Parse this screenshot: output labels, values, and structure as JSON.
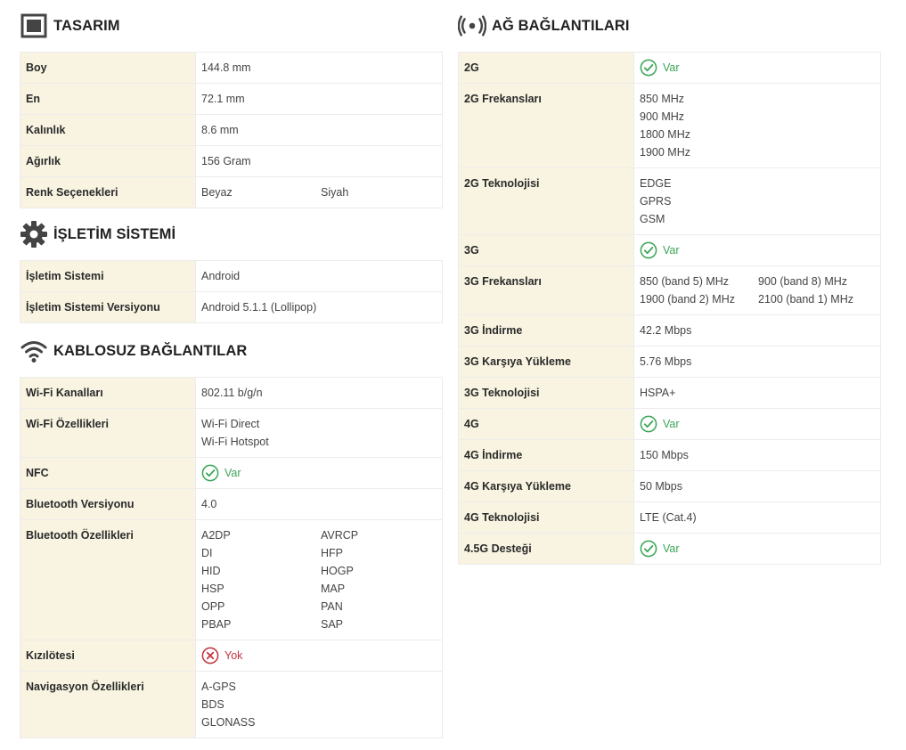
{
  "colors": {
    "key_bg": "#f8f4e1",
    "border": "#ececec",
    "yes": "#3aa556",
    "no": "#c2323d"
  },
  "left": {
    "design": {
      "title": "TASARIM",
      "icon": "frame-icon",
      "rows": [
        {
          "k": "Boy",
          "v": [
            "144.8 mm"
          ]
        },
        {
          "k": "En",
          "v": [
            "72.1 mm"
          ]
        },
        {
          "k": "Kalınlık",
          "v": [
            "8.6 mm"
          ]
        },
        {
          "k": "Ağırlık",
          "v": [
            "156 Gram"
          ]
        },
        {
          "k": "Renk Seçenekleri",
          "grid": [
            "Beyaz",
            "Siyah"
          ]
        }
      ]
    },
    "os": {
      "title": "İŞLETİM SİSTEMİ",
      "icon": "gear-icon",
      "rows": [
        {
          "k": "İşletim Sistemi",
          "v": [
            "Android"
          ]
        },
        {
          "k": "İşletim Sistemi Versiyonu",
          "v": [
            "Android 5.1.1 (Lollipop)"
          ]
        }
      ]
    },
    "wireless": {
      "title": "KABLOSUZ BAĞLANTILAR",
      "icon": "wifi-icon",
      "rows": [
        {
          "k": "Wi-Fi Kanalları",
          "v": [
            "802.11 b/g/n"
          ]
        },
        {
          "k": "Wi-Fi Özellikleri",
          "v": [
            "Wi-Fi Direct",
            "Wi-Fi Hotspot"
          ]
        },
        {
          "k": "NFC",
          "status": "yes",
          "label": "Var"
        },
        {
          "k": "Bluetooth Versiyonu",
          "v": [
            "4.0"
          ]
        },
        {
          "k": "Bluetooth Özellikleri",
          "grid": [
            "A2DP",
            "AVRCP",
            "DI",
            "HFP",
            "HID",
            "HOGP",
            "HSP",
            "MAP",
            "OPP",
            "PAN",
            "PBAP",
            "SAP"
          ]
        },
        {
          "k": "Kızılötesi",
          "status": "no",
          "label": "Yok"
        },
        {
          "k": "Navigasyon Özellikleri",
          "v": [
            "A-GPS",
            "BDS",
            "GLONASS"
          ]
        }
      ]
    }
  },
  "right": {
    "network": {
      "title": "AĞ BAĞLANTILARI",
      "icon": "broadcast-icon",
      "rows": [
        {
          "k": "2G",
          "status": "yes",
          "label": "Var"
        },
        {
          "k": "2G Frekansları",
          "v": [
            "850 MHz",
            "900 MHz",
            "1800 MHz",
            "1900 MHz"
          ]
        },
        {
          "k": "2G Teknolojisi",
          "v": [
            "EDGE",
            "GPRS",
            "GSM"
          ]
        },
        {
          "k": "3G",
          "status": "yes",
          "label": "Var"
        },
        {
          "k": "3G Frekansları",
          "gridw": [
            "850 (band 5) MHz",
            "900 (band 8) MHz",
            "1900 (band 2) MHz",
            "2100 (band 1) MHz"
          ]
        },
        {
          "k": "3G İndirme",
          "v": [
            "42.2 Mbps"
          ]
        },
        {
          "k": "3G Karşıya Yükleme",
          "v": [
            "5.76 Mbps"
          ]
        },
        {
          "k": "3G Teknolojisi",
          "v": [
            "HSPA+"
          ]
        },
        {
          "k": "4G",
          "status": "yes",
          "label": "Var"
        },
        {
          "k": "4G İndirme",
          "v": [
            "150 Mbps"
          ]
        },
        {
          "k": "4G Karşıya Yükleme",
          "v": [
            "50 Mbps"
          ]
        },
        {
          "k": "4G Teknolojisi",
          "v": [
            "LTE (Cat.4)"
          ]
        },
        {
          "k": "4.5G Desteği",
          "status": "yes",
          "label": "Var"
        }
      ]
    }
  }
}
